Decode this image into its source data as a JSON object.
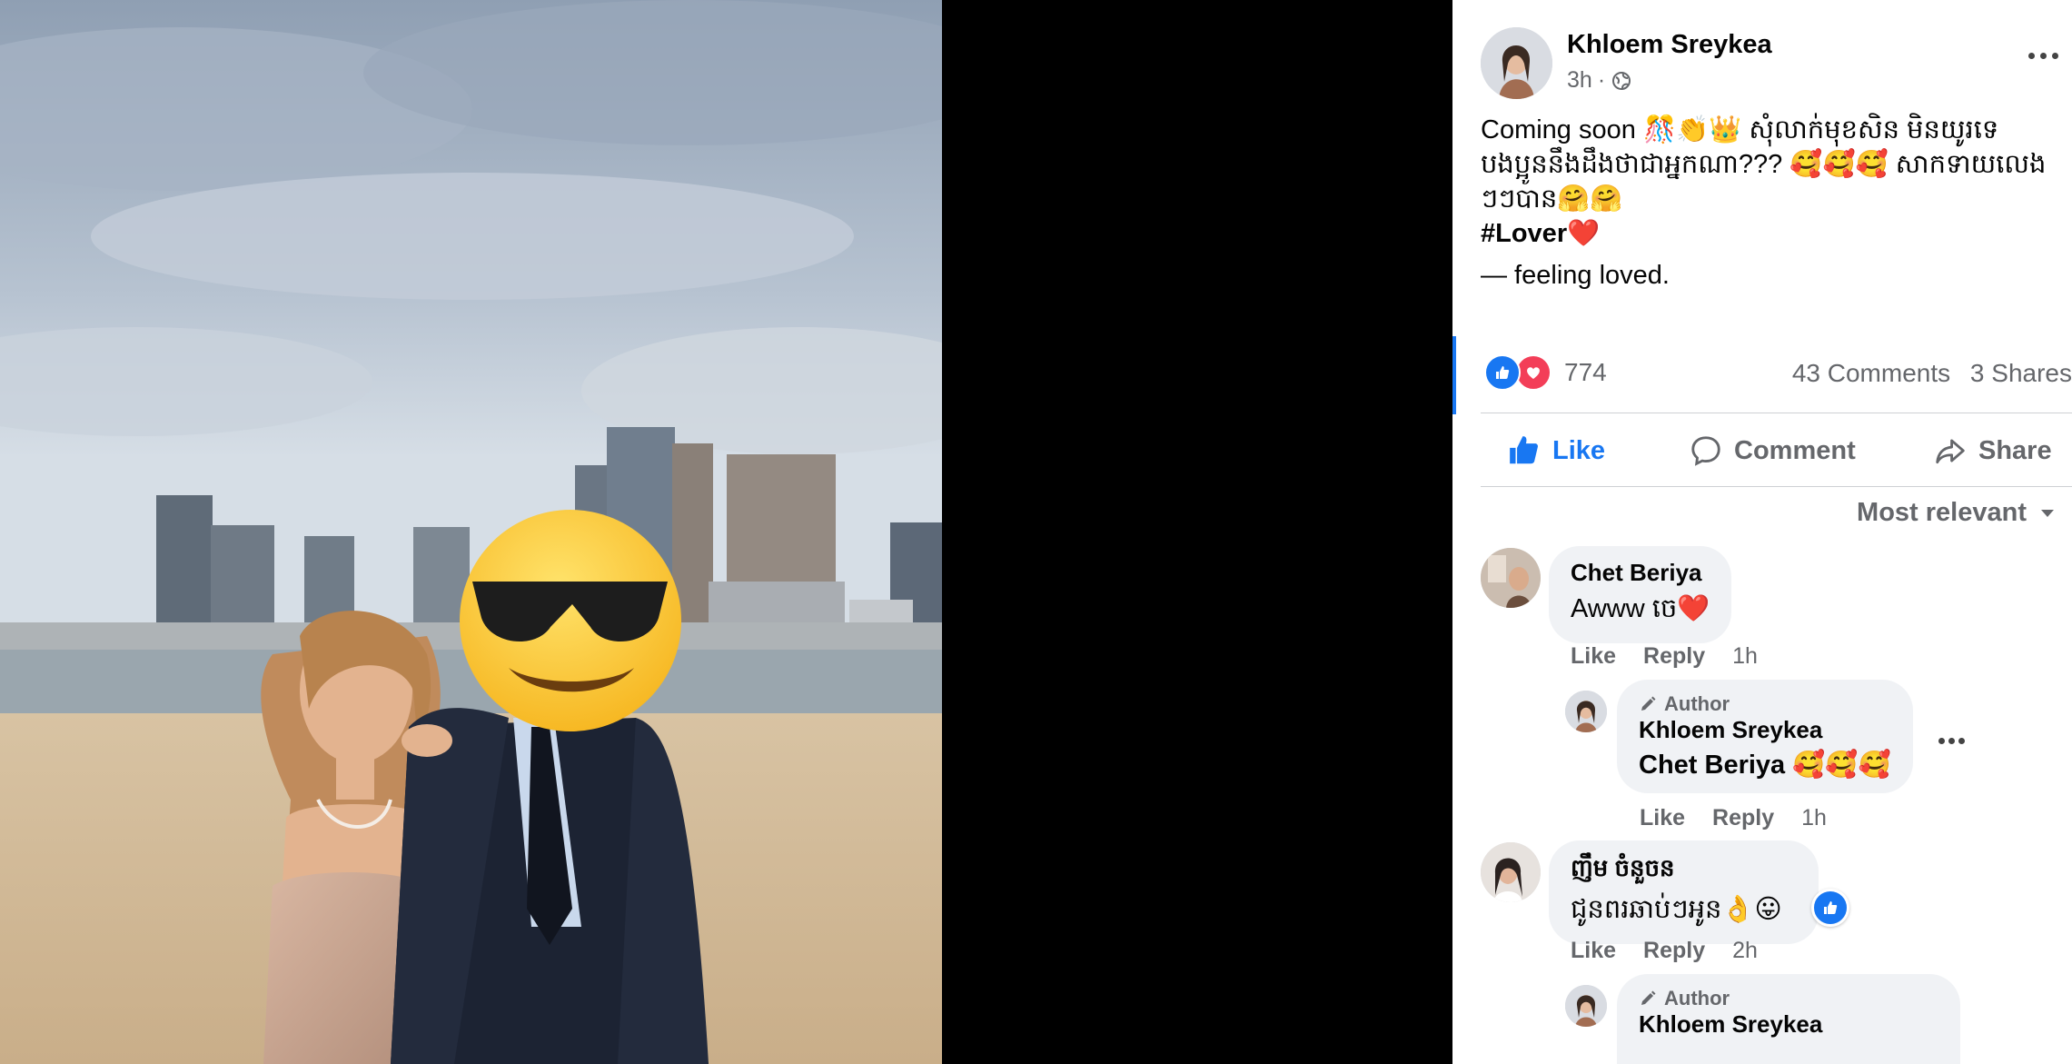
{
  "post": {
    "author": "Khloem Sreykea",
    "time": "3h",
    "text_lines": [
      "Coming soon",
      "សុំលាក់មុខសិន មិនយូរទេ",
      "បងប្អូននឹងដឹងថាជាអ្នកណា???",
      "សាកទាយលេង",
      "ៗៗបាន"
    ],
    "hashtag": "#Lover",
    "feeling": "— feeling loved.",
    "reaction_count": "774",
    "comments_count": "43 Comments",
    "shares_count": "3 Shares"
  },
  "actions": {
    "like": "Like",
    "comment": "Comment",
    "share": "Share"
  },
  "sort_label": "Most relevant",
  "comments": [
    {
      "name": "Chet Beriya",
      "text": "Awww ចេ",
      "like": "Like",
      "reply": "Reply",
      "time": "1h"
    },
    {
      "badge": "Author",
      "name": "Khloem Sreykea",
      "text": "Chet Beriya",
      "like": "Like",
      "reply": "Reply",
      "time": "1h"
    },
    {
      "name": "ញឹម ចំនួចន",
      "text": "ជូនពរឆាប់ៗអូន",
      "like": "Like",
      "reply": "Reply",
      "time": "2h"
    },
    {
      "badge": "Author",
      "name": "Khloem Sreykea"
    }
  ],
  "colors": {
    "accent": "#1877f2",
    "love": "#f33e58",
    "muted": "#65676b",
    "bubble": "#f0f2f5"
  }
}
